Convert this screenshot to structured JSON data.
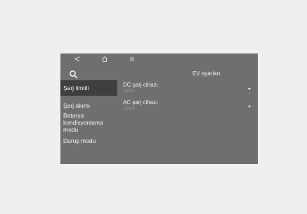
{
  "nav": {
    "back_glyph": "<",
    "home_icon": "home-icon",
    "menu_icon": "menu-icon"
  },
  "header": {
    "search_icon": "search-icon",
    "title": "EV ayarları"
  },
  "sidebar": {
    "items": [
      {
        "label": "Şarj limitli",
        "active": true
      },
      {
        "label": "Şarj akımı",
        "active": false
      },
      {
        "label": "Batarya kondisyonlama modu",
        "active": false
      },
      {
        "label": "Duruş modu",
        "active": false
      }
    ]
  },
  "settings": [
    {
      "label": "DC şarj cihazı",
      "value": "100%"
    },
    {
      "label": "AC şarj cihazı",
      "value": "100%"
    }
  ],
  "colors": {
    "background": "#efefef",
    "screen": "#6f6f6f",
    "active_item": "#3f3f3f",
    "text": "#f2f2f2",
    "muted_text": "#9a9a9a"
  }
}
